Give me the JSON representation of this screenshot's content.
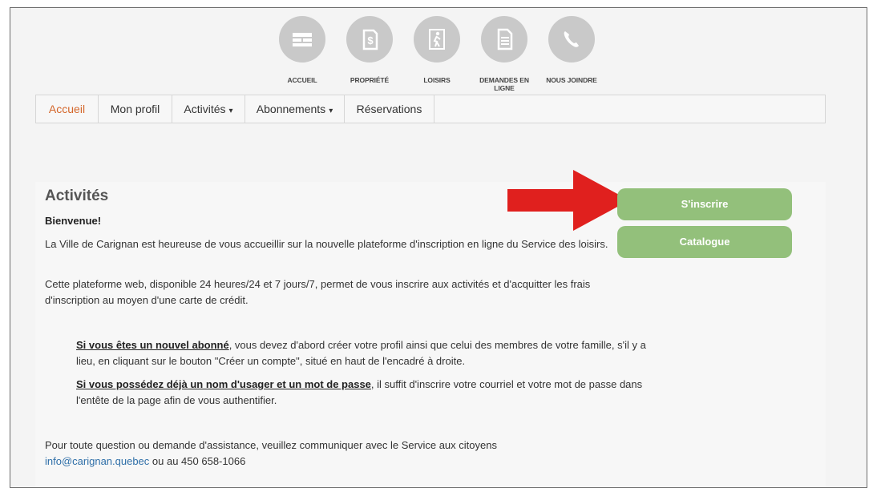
{
  "topnav": {
    "items": [
      {
        "label": "ACCUEIL",
        "icon": "home-icon"
      },
      {
        "label": "PROPRIÉTÉ",
        "icon": "property-tax-icon"
      },
      {
        "label": "LOISIRS",
        "icon": "leisure-icon"
      },
      {
        "label": "DEMANDES EN LIGNE",
        "icon": "document-icon"
      },
      {
        "label": "NOUS JOINDRE",
        "icon": "phone-icon"
      }
    ]
  },
  "menu": {
    "items": [
      {
        "label": "Accueil",
        "active": true
      },
      {
        "label": "Mon profil"
      },
      {
        "label": "Activités",
        "caret": "▾"
      },
      {
        "label": "Abonnements",
        "caret": "▾"
      },
      {
        "label": "Réservations"
      }
    ]
  },
  "content": {
    "title": "Activités",
    "welcome": "Bienvenue!",
    "p1": "La Ville de Carignan est heureuse de vous accueillir sur la nouvelle plateforme d'inscription en ligne du Service des loisirs.",
    "p2": "Cette plateforme web, disponible 24 heures/24 et 7 jours/7, permet de vous inscrire aux activités et d'acquitter les frais d'inscription au moyen d'une carte de crédit.",
    "p3_strong": "Si vous êtes un nouvel abonné",
    "p3_rest": ", vous devez d'abord créer votre profil ainsi que celui des membres de votre famille, s'il y a lieu, en cliquant sur le bouton \"Créer un compte\", situé en haut de l'encadré à droite.",
    "p4_strong": "Si vous possédez déjà un nom d'usager et un mot de passe",
    "p4_rest": ", il suffit d'inscrire votre courriel et votre mot de passe dans l'entête de la page afin de vous authentifier.",
    "p5": "Pour toute question ou demande d'assistance, veuillez communiquer avec le Service aux citoyens",
    "email": "info@carignan.quebec",
    "phone_text": " ou au 450 658-1066"
  },
  "buttons": {
    "register": "S'inscrire",
    "catalogue": "Catalogue"
  },
  "colors": {
    "accent": "#d4662a",
    "button": "#93c07b",
    "arrow": "#e0201e",
    "link": "#2f6fa8",
    "icon_circle": "#c9c9c9"
  }
}
